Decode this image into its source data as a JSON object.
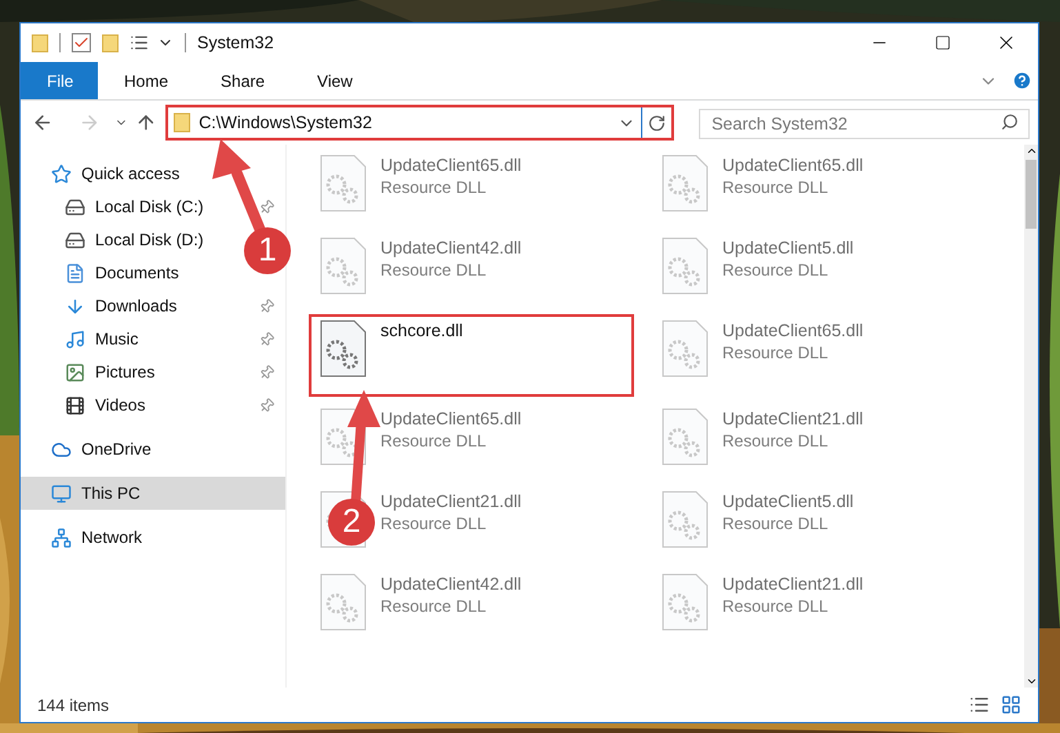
{
  "window": {
    "title": "System32"
  },
  "ribbon": {
    "tabs": [
      {
        "label": "File",
        "kind": "file",
        "selected": false
      },
      {
        "label": "Home",
        "kind": "tab",
        "selected": false
      },
      {
        "label": "Share",
        "kind": "tab",
        "selected": false
      },
      {
        "label": "View",
        "kind": "tab",
        "selected": false
      }
    ]
  },
  "address": {
    "value": "C:\\Windows\\System32",
    "highlighted": true
  },
  "search": {
    "placeholder": "Search System32"
  },
  "sidebar": {
    "items": [
      {
        "label": "Quick access",
        "kind": "star",
        "selected": false,
        "children": [
          {
            "label": "Local Disk (C:)",
            "kind": "drive_c",
            "pinned": true,
            "selected": false
          },
          {
            "label": "Local Disk (D:)",
            "kind": "drive",
            "pinned": false,
            "selected": false
          },
          {
            "label": "Documents",
            "kind": "documents",
            "pinned": false,
            "selected": false
          },
          {
            "label": "Downloads",
            "kind": "downloads",
            "pinned": true,
            "selected": false
          },
          {
            "label": "Music",
            "kind": "music",
            "pinned": true,
            "selected": false
          },
          {
            "label": "Pictures",
            "kind": "pictures",
            "pinned": true,
            "selected": false
          },
          {
            "label": "Videos",
            "kind": "videos",
            "pinned": true,
            "selected": false
          }
        ]
      },
      {
        "label": "OneDrive",
        "kind": "cloud",
        "selected": false
      },
      {
        "label": "This PC",
        "kind": "pc",
        "selected": true
      },
      {
        "label": "Network",
        "kind": "network",
        "selected": false
      }
    ]
  },
  "files": [
    {
      "name": "UpdateClient65.dll",
      "type": "Resource DLL",
      "blurred": true,
      "highlighted": false
    },
    {
      "name": "UpdateClient65.dll",
      "type": "Resource DLL",
      "blurred": true,
      "highlighted": false
    },
    {
      "name": "UpdateClient42.dll",
      "type": "Resource DLL",
      "blurred": true,
      "highlighted": false
    },
    {
      "name": "UpdateClient5.dll",
      "type": "Resource DLL",
      "blurred": true,
      "highlighted": false
    },
    {
      "name": "schcore.dll",
      "blurred": false,
      "highlighted": true
    },
    {
      "name": "UpdateClient65.dll",
      "type": "Resource DLL",
      "blurred": true,
      "highlighted": false
    },
    {
      "name": "UpdateClient65.dll",
      "type": "Resource DLL",
      "blurred": true,
      "highlighted": false
    },
    {
      "name": "UpdateClient21.dll",
      "type": "Resource DLL",
      "blurred": true,
      "highlighted": false
    },
    {
      "name": "UpdateClient21.dll",
      "type": "Resource DLL",
      "blurred": true,
      "highlighted": false
    },
    {
      "name": "UpdateClient5.dll",
      "type": "Resource DLL",
      "blurred": true,
      "highlighted": false
    },
    {
      "name": "UpdateClient42.dll",
      "type": "Resource DLL",
      "blurred": true,
      "highlighted": false
    },
    {
      "name": "UpdateClient21.dll",
      "type": "Resource DLL",
      "blurred": true,
      "highlighted": false
    }
  ],
  "status_bar": {
    "count": "144 items"
  },
  "callouts": [
    {
      "number": "1"
    },
    {
      "number": "2"
    }
  ]
}
